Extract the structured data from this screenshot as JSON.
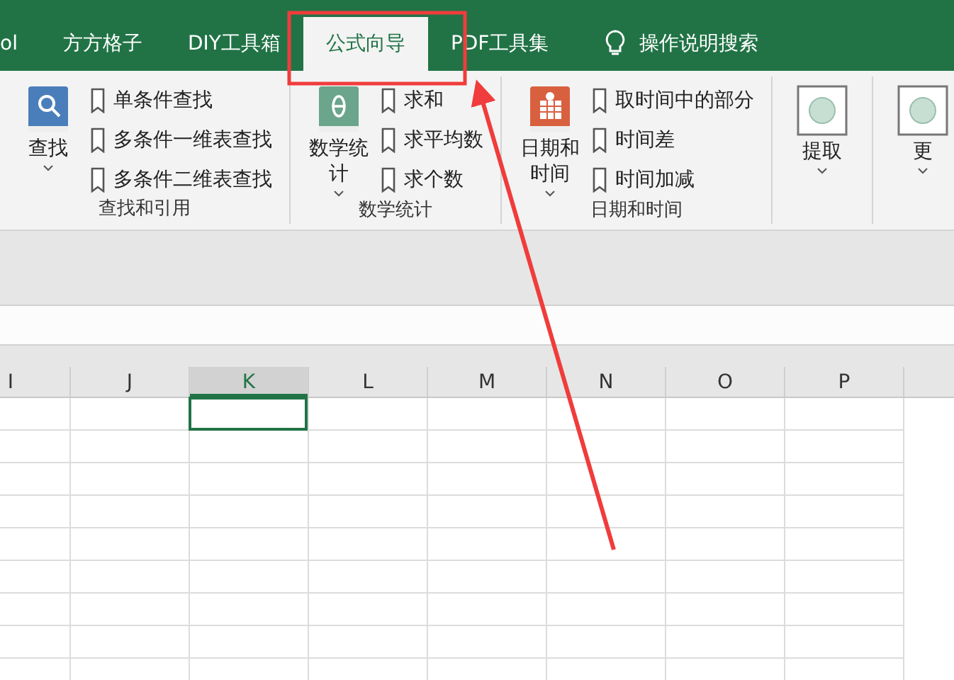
{
  "tabs": [
    {
      "label": "ol",
      "selected": false
    },
    {
      "label": "方方格子",
      "selected": false
    },
    {
      "label": "DIY工具箱",
      "selected": false
    },
    {
      "label": "公式向导",
      "selected": true
    },
    {
      "label": "PDF工具集",
      "selected": false
    }
  ],
  "tell_me": {
    "label": "操作说明搜索"
  },
  "ribbon_groups": [
    {
      "kind": "book",
      "big_label": "查找",
      "items": [
        "单条件查找",
        "多条件一维表查找",
        "多条件二维表查找"
      ],
      "label": "查找和引用"
    },
    {
      "kind": "book",
      "big_label": "数学统计",
      "items": [
        "求和",
        "求平均数",
        "求个数"
      ],
      "label": "数学统计"
    },
    {
      "kind": "book",
      "big_label": "日期和时间",
      "items": [
        "取时间中的部分",
        "时间差",
        "时间加减"
      ],
      "label": "日期和时间"
    },
    {
      "kind": "plain",
      "big_label": "提取"
    },
    {
      "kind": "plain",
      "big_label": "更"
    }
  ],
  "columns": [
    {
      "label": "I",
      "selected": false
    },
    {
      "label": "J",
      "selected": false
    },
    {
      "label": "K",
      "selected": true
    },
    {
      "label": "L",
      "selected": false
    },
    {
      "label": "M",
      "selected": false
    },
    {
      "label": "N",
      "selected": false
    },
    {
      "label": "O",
      "selected": false
    },
    {
      "label": "P",
      "selected": false
    }
  ]
}
